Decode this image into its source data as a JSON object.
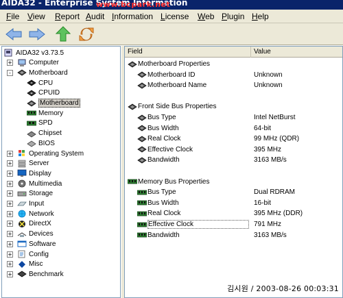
{
  "window": {
    "title": "AIDA32 - Enterprise System Information",
    "watermark_url": "www.bcpark.net"
  },
  "menu": [
    {
      "label": "File",
      "u": "F"
    },
    {
      "label": "View",
      "u": "V"
    },
    {
      "label": "Report",
      "u": "R"
    },
    {
      "label": "Audit",
      "u": "A"
    },
    {
      "label": "Information",
      "u": "I"
    },
    {
      "label": "License",
      "u": "L"
    },
    {
      "label": "Web",
      "u": "W"
    },
    {
      "label": "Plugin",
      "u": "P"
    },
    {
      "label": "Help",
      "u": "H"
    }
  ],
  "toolbar": [
    {
      "name": "back-icon"
    },
    {
      "name": "forward-icon"
    },
    {
      "name": "up-icon"
    },
    {
      "name": "refresh-icon"
    }
  ],
  "tree": {
    "root": "AIDA32 v3.73.5",
    "items": [
      {
        "label": "Computer",
        "icon": "computer-icon",
        "expander": "+"
      },
      {
        "label": "Motherboard",
        "icon": "motherboard-icon",
        "expander": "-"
      },
      {
        "label": "CPU",
        "icon": "cpu-icon"
      },
      {
        "label": "CPUID",
        "icon": "cpuid-icon"
      },
      {
        "label": "Motherboard",
        "icon": "motherboard-icon",
        "selected": true
      },
      {
        "label": "Memory",
        "icon": "memory-icon"
      },
      {
        "label": "SPD",
        "icon": "spd-icon"
      },
      {
        "label": "Chipset",
        "icon": "chipset-icon"
      },
      {
        "label": "BIOS",
        "icon": "bios-icon"
      },
      {
        "label": "Operating System",
        "icon": "windows-icon",
        "expander": "+"
      },
      {
        "label": "Server",
        "icon": "server-icon",
        "expander": "+"
      },
      {
        "label": "Display",
        "icon": "display-icon",
        "expander": "+"
      },
      {
        "label": "Multimedia",
        "icon": "multimedia-icon",
        "expander": "+"
      },
      {
        "label": "Storage",
        "icon": "storage-icon",
        "expander": "+"
      },
      {
        "label": "Input",
        "icon": "input-icon",
        "expander": "+"
      },
      {
        "label": "Network",
        "icon": "network-icon",
        "expander": "+"
      },
      {
        "label": "DirectX",
        "icon": "directx-icon",
        "expander": "+"
      },
      {
        "label": "Devices",
        "icon": "devices-icon",
        "expander": "+"
      },
      {
        "label": "Software",
        "icon": "software-icon",
        "expander": "+"
      },
      {
        "label": "Config",
        "icon": "config-icon",
        "expander": "+"
      },
      {
        "label": "Misc",
        "icon": "misc-icon",
        "expander": "+"
      },
      {
        "label": "Benchmark",
        "icon": "benchmark-icon",
        "expander": "+"
      }
    ]
  },
  "detail": {
    "col_field": "Field",
    "col_value": "Value",
    "rows": [
      {
        "kind": "group",
        "field": "Motherboard Properties",
        "icon": "motherboard-icon"
      },
      {
        "kind": "item",
        "field": "Motherboard ID",
        "value": "Unknown",
        "icon": "motherboard-icon"
      },
      {
        "kind": "item",
        "field": "Motherboard Name",
        "value": "Unknown",
        "icon": "motherboard-icon"
      },
      {
        "kind": "blank"
      },
      {
        "kind": "group",
        "field": "Front Side Bus Properties",
        "icon": "motherboard-icon"
      },
      {
        "kind": "item",
        "field": "Bus Type",
        "value": "Intel NetBurst",
        "icon": "motherboard-icon"
      },
      {
        "kind": "item",
        "field": "Bus Width",
        "value": "64-bit",
        "icon": "motherboard-icon"
      },
      {
        "kind": "item",
        "field": "Real Clock",
        "value": "99 MHz (QDR)",
        "icon": "motherboard-icon"
      },
      {
        "kind": "item",
        "field": "Effective Clock",
        "value": "395 MHz",
        "icon": "motherboard-icon"
      },
      {
        "kind": "item",
        "field": "Bandwidth",
        "value": "3163 MB/s",
        "icon": "motherboard-icon"
      },
      {
        "kind": "blank"
      },
      {
        "kind": "group",
        "field": "Memory Bus Properties",
        "icon": "memory-icon"
      },
      {
        "kind": "item",
        "field": "Bus Type",
        "value": "Dual RDRAM",
        "icon": "memory-icon"
      },
      {
        "kind": "item",
        "field": "Bus Width",
        "value": "16-bit",
        "icon": "memory-icon"
      },
      {
        "kind": "item",
        "field": "Real Clock",
        "value": "395 MHz (DDR)",
        "icon": "memory-icon"
      },
      {
        "kind": "item",
        "field": "Effective Clock",
        "value": "791 MHz",
        "icon": "memory-icon",
        "focused": true
      },
      {
        "kind": "item",
        "field": "Bandwidth",
        "value": "3163 MB/s",
        "icon": "memory-icon"
      }
    ]
  },
  "footer": {
    "watermark": "김시원 / 2003-08-26 00:03:31"
  },
  "colors": {
    "titlebar": "#0a246a",
    "watermark_red": "#ff2a2a",
    "chrome": "#ece9d8"
  }
}
